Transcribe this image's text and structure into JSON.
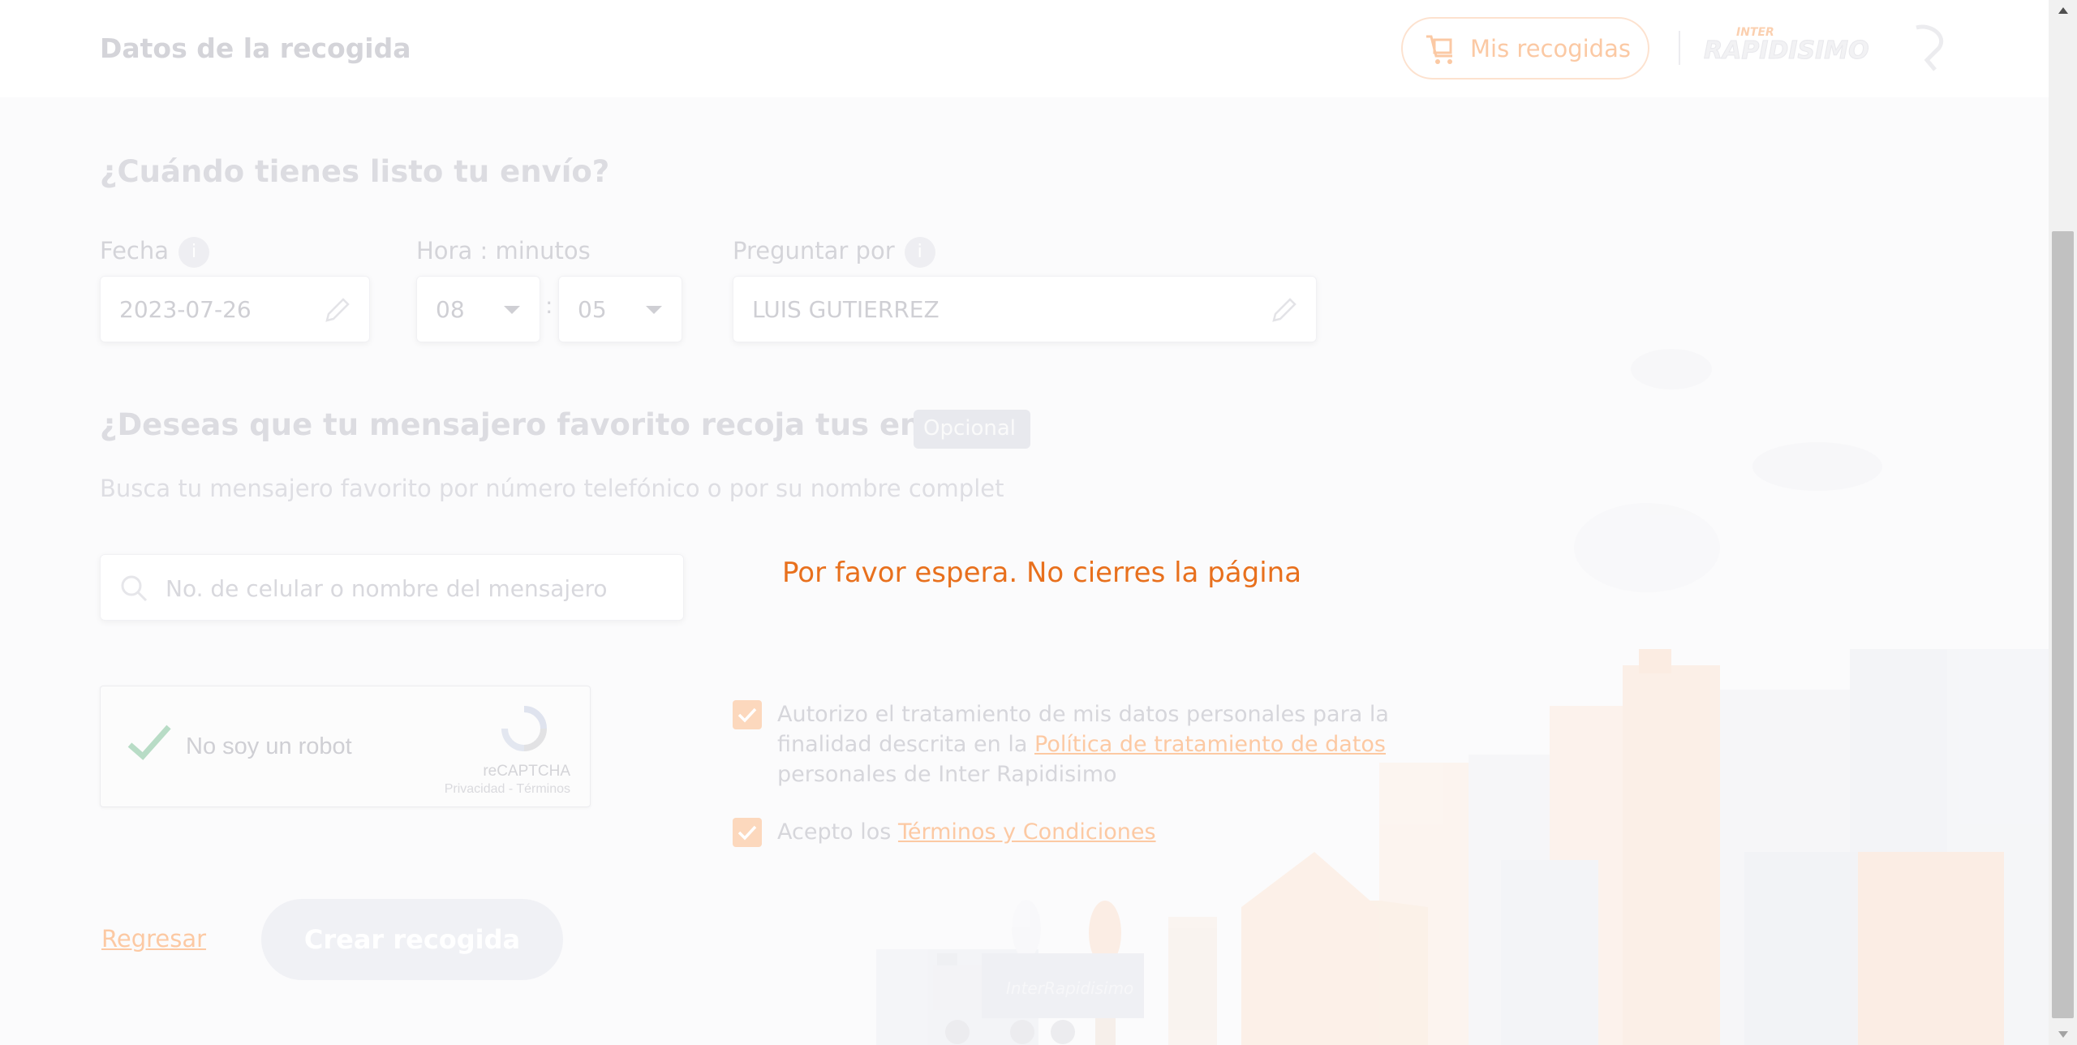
{
  "header": {
    "title": "Datos de la recogida",
    "mis_recogidas_label": "Mis recogidas",
    "logo_top": "INTER",
    "logo_main": "RAPIDISIMO"
  },
  "when_section": {
    "title": "¿Cuándo tienes listo tu envío?",
    "fecha_label": "Fecha",
    "fecha_value": "2023-07-26",
    "hora_label": "Hora : minutos",
    "hour_value": "08",
    "time_separator": ":",
    "minute_value": "05",
    "preguntar_label": "Preguntar por",
    "preguntar_value": "LUIS GUTIERREZ",
    "info_glyph": "i"
  },
  "favorite_section": {
    "title": "¿Deseas que tu mensajero favorito recoja tus envíos?",
    "badge": "Opcional",
    "subtitle": "Busca tu mensajero favorito por número telefónico o por su nombre complet",
    "search_placeholder": "No. de celular o nombre del mensajero"
  },
  "captcha": {
    "label": "No soy un robot",
    "brand": "reCAPTCHA",
    "links": "Privacidad - Términos"
  },
  "consent": {
    "data_text_1": "Autorizo el tratamiento de mis datos personales para la finalidad descrita en la ",
    "data_link": "Política de tratamiento de datos ",
    "data_text_2": "personales de Inter Rapidisimo",
    "terms_text": "Acepto los ",
    "terms_link": "Términos y Condiciones"
  },
  "actions": {
    "back_label": "Regresar",
    "create_label": "Crear recogida"
  },
  "overlay": {
    "message": "Por favor espera. No cierres la página"
  },
  "illustration": {
    "truck_brand": "InterRapidisimo"
  },
  "colors": {
    "accent": "#e8701d",
    "accent_faded": "#fcc9a3"
  }
}
